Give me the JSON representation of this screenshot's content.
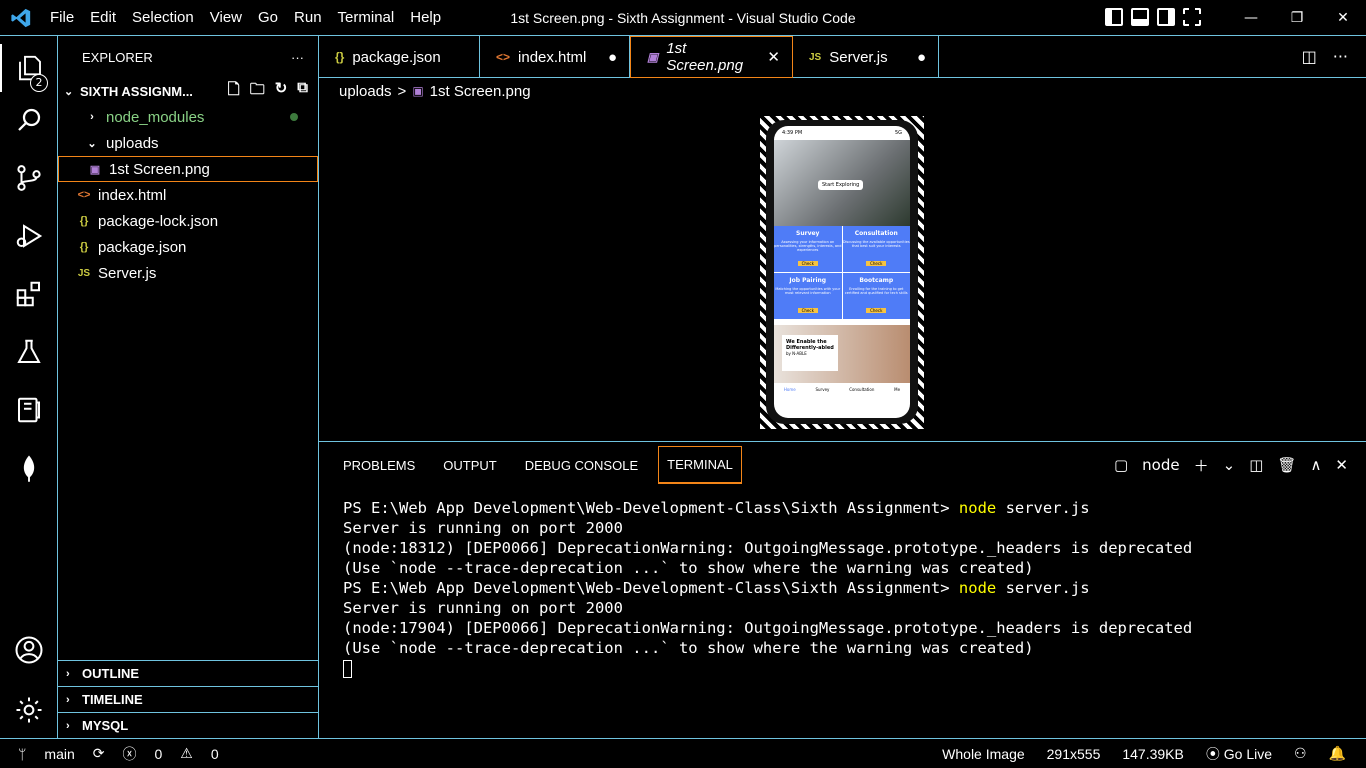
{
  "titlebar": {
    "menu": [
      "File",
      "Edit",
      "Selection",
      "View",
      "Go",
      "Run",
      "Terminal",
      "Help"
    ],
    "title": "1st Screen.png - Sixth Assignment - Visual Studio Code"
  },
  "activity": {
    "explorer_badge": "2"
  },
  "explorer": {
    "header": "EXPLORER",
    "folder": "SIXTH ASSIGNM...",
    "items": [
      {
        "label": "node_modules",
        "icon": "chevron-right-icon",
        "color": "#89d185"
      },
      {
        "label": "uploads",
        "icon": "chevron-down-icon"
      },
      {
        "label": "1st Screen.png",
        "icon": "image-file-icon"
      },
      {
        "label": "index.html",
        "icon": "html-file-icon",
        "glyph": "<>"
      },
      {
        "label": "package-lock.json",
        "icon": "json-file-icon",
        "glyph": "{}"
      },
      {
        "label": "package.json",
        "icon": "json-file-icon",
        "glyph": "{}"
      },
      {
        "label": "Server.js",
        "icon": "js-file-icon",
        "glyph": "JS"
      }
    ],
    "sections": [
      "OUTLINE",
      "TIMELINE",
      "MYSQL"
    ]
  },
  "tabs": [
    {
      "label": "package.json",
      "glyph": "{}",
      "state": ""
    },
    {
      "label": "index.html",
      "glyph": "<>",
      "state": "●"
    },
    {
      "label": "1st Screen.png",
      "glyph": "img",
      "state": "✕"
    },
    {
      "label": "Server.js",
      "glyph": "JS",
      "state": "●"
    }
  ],
  "breadcrumb": {
    "folder": "uploads",
    "sep": ">",
    "file": "1st Screen.png"
  },
  "phone": {
    "time": "4:39 PM",
    "signal": "5G",
    "hero_button": "Start Exploring",
    "cards": [
      {
        "title": "Survey",
        "text": "Assessing your information on personalities, strengths, interests, and experiences",
        "btn": "Check"
      },
      {
        "title": "Consultation",
        "text": "Discussing the available opportunities that best suit your interests",
        "btn": "Check"
      },
      {
        "title": "Job Pairing",
        "text": "Matching the opportunities with your most relevant information",
        "btn": "Check"
      },
      {
        "title": "Bootcamp",
        "text": "Enrolling for the training to get certified and qualified for tech skills",
        "btn": "Check"
      }
    ],
    "banner": "We Enable the Differently-abled",
    "banner_by": "by N-ABLE",
    "nav": [
      "Home",
      "Survey",
      "Consultation",
      "Me"
    ]
  },
  "panel": {
    "tabs": [
      "PROBLEMS",
      "OUTPUT",
      "DEBUG CONSOLE",
      "TERMINAL"
    ],
    "terminal_name": "node"
  },
  "terminal": {
    "prompt": "PS E:\\Web App Development\\Web-Development-Class\\Sixth Assignment> ",
    "cmd": "node",
    "arg": " server.js",
    "running": "Server is running on port 2000",
    "warn1": "(node:18312) [DEP0066] DeprecationWarning: OutgoingMessage.prototype._headers is deprecated",
    "warn2": "(node:17904) [DEP0066] DeprecationWarning: OutgoingMessage.prototype._headers is deprecated",
    "hint": "(Use `node --trace-deprecation ...` to show where the warning was created)"
  },
  "status": {
    "branch": "main",
    "errors": "0",
    "warnings": "0",
    "view": "Whole Image",
    "dims": "291x555",
    "size": "147.39KB",
    "golive": "Go Live"
  },
  "colors": {
    "accent": "#6fc3df",
    "active_border": "#f38518",
    "cmd": "#ffff00"
  }
}
